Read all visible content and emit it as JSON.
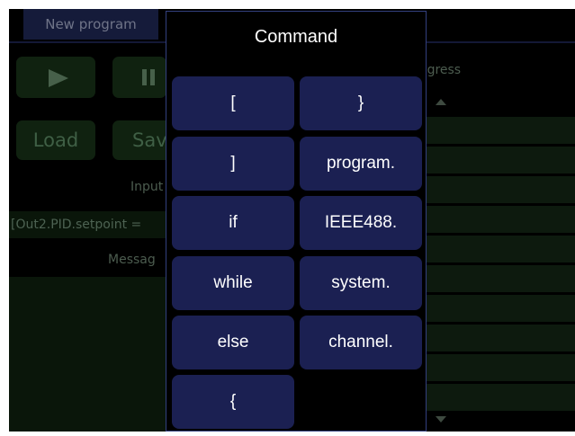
{
  "app": {
    "tab_label": "New program",
    "load_label": "Load",
    "save_label": "Sav",
    "input_label": "Input",
    "code_line": "[Out2.PID.setpoint =",
    "message_label": "Messag",
    "progress_label": "ogress"
  },
  "dialog": {
    "title": "Command",
    "buttons": [
      "[",
      "}",
      "]",
      "program.",
      "if",
      "IEEE488.",
      "while",
      "system.",
      "else",
      "channel.",
      "{"
    ]
  }
}
